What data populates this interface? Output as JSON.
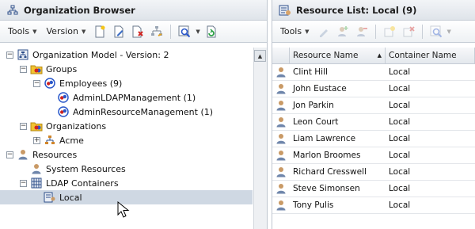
{
  "left": {
    "title": "Organization Browser",
    "toolbar": {
      "tools_label": "Tools",
      "version_label": "Version"
    },
    "tree": [
      {
        "label": "Organization Model - Version: 2",
        "toggle": "−",
        "icon": "org-model",
        "indent": 0
      },
      {
        "label": "Groups",
        "toggle": "−",
        "icon": "folder",
        "indent": 1
      },
      {
        "label": "Employees  (9)",
        "toggle": "−",
        "icon": "group",
        "indent": 2
      },
      {
        "label": "AdminLDAPManagement  (1)",
        "toggle": "",
        "icon": "group",
        "indent": 3
      },
      {
        "label": "AdminResourceManagement  (1)",
        "toggle": "",
        "icon": "group",
        "indent": 3
      },
      {
        "label": "Organizations",
        "toggle": "−",
        "icon": "folder",
        "indent": 1
      },
      {
        "label": "Acme",
        "toggle": "+",
        "icon": "org",
        "indent": 2
      },
      {
        "label": "Resources",
        "toggle": "−",
        "icon": "person",
        "indent": 0
      },
      {
        "label": "System Resources",
        "toggle": "",
        "icon": "person",
        "indent": 1
      },
      {
        "label": "LDAP Containers",
        "toggle": "−",
        "icon": "ldap",
        "indent": 1
      },
      {
        "label": "Local",
        "toggle": "",
        "icon": "container",
        "indent": 2,
        "selected": true
      }
    ]
  },
  "right": {
    "title": "Resource List: Local (9)",
    "toolbar": {
      "tools_label": "Tools"
    },
    "columns": {
      "name": "Resource Name",
      "container": "Container Name"
    },
    "rows": [
      {
        "name": "Clint Hill",
        "container": "Local"
      },
      {
        "name": "John Eustace",
        "container": "Local"
      },
      {
        "name": "Jon Parkin",
        "container": "Local"
      },
      {
        "name": "Leon Court",
        "container": "Local"
      },
      {
        "name": "Liam Lawrence",
        "container": "Local"
      },
      {
        "name": "Marlon Broomes",
        "container": "Local"
      },
      {
        "name": "Richard Cresswell",
        "container": "Local"
      },
      {
        "name": "Steve Simonsen",
        "container": "Local"
      },
      {
        "name": "Tony Pulis",
        "container": "Local"
      }
    ]
  },
  "colors": {
    "selected_row": "#cfd8e3",
    "header_bg": "#e4e8ed",
    "group_red": "#d0231f",
    "group_blue": "#2a57c9",
    "folder_yellow": "#f2c230"
  }
}
